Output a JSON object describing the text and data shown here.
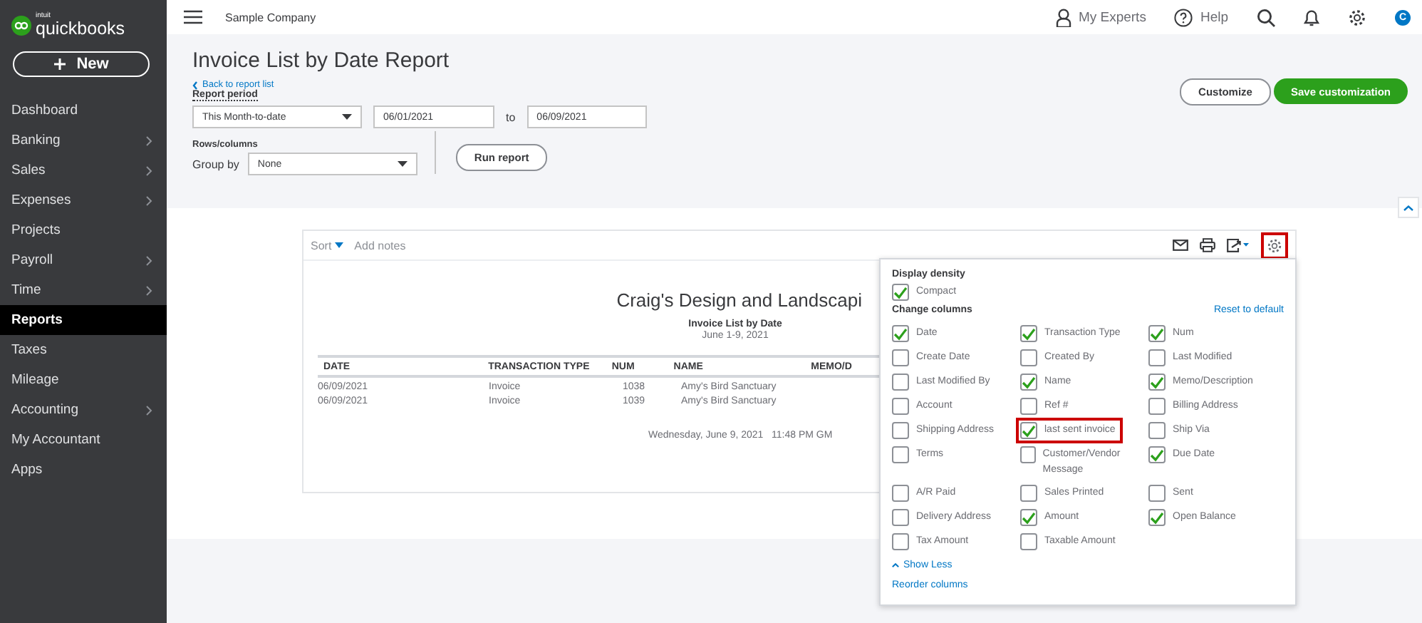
{
  "brand": {
    "small": "intuit",
    "name": "quickbooks"
  },
  "new_button": "New",
  "sidebar": {
    "items": [
      {
        "label": "Dashboard",
        "has_submenu": false,
        "selected": false
      },
      {
        "label": "Banking",
        "has_submenu": true,
        "selected": false
      },
      {
        "label": "Sales",
        "has_submenu": true,
        "selected": false
      },
      {
        "label": "Expenses",
        "has_submenu": true,
        "selected": false
      },
      {
        "label": "Projects",
        "has_submenu": false,
        "selected": false
      },
      {
        "label": "Payroll",
        "has_submenu": true,
        "selected": false
      },
      {
        "label": "Time",
        "has_submenu": true,
        "selected": false
      },
      {
        "label": "Reports",
        "has_submenu": false,
        "selected": true
      },
      {
        "label": "Taxes",
        "has_submenu": false,
        "selected": false
      },
      {
        "label": "Mileage",
        "has_submenu": false,
        "selected": false
      },
      {
        "label": "Accounting",
        "has_submenu": true,
        "selected": false
      },
      {
        "label": "My Accountant",
        "has_submenu": false,
        "selected": false
      },
      {
        "label": "Apps",
        "has_submenu": false,
        "selected": false
      }
    ]
  },
  "topbar": {
    "company": "Sample Company",
    "experts": "My Experts",
    "help": "Help",
    "avatar": "C"
  },
  "header": {
    "title": "Invoice List by Date Report",
    "back_link": "Back to report list",
    "period_label": "Report period",
    "period": "This Month-to-date",
    "from": "06/01/2021",
    "to_label": "to",
    "to": "06/09/2021",
    "rows_label": "Rows/columns",
    "group_label": "Group by",
    "group": "None",
    "run": "Run report",
    "customize": "Customize",
    "save": "Save customization"
  },
  "report": {
    "sort": "Sort",
    "notes": "Add notes",
    "settings_highlighted": true,
    "company": "Craig's Design and Landscapi",
    "title": "Invoice List by Date",
    "range": "June 1-9, 2021",
    "columns": [
      "DATE",
      "TRANSACTION TYPE",
      "NUM",
      "NAME",
      "MEMO/D"
    ],
    "rows": [
      [
        "06/09/2021",
        "Invoice",
        "1038",
        "Amy's Bird Sanctuary"
      ],
      [
        "06/09/2021",
        "Invoice",
        "1039",
        "Amy's Bird Sanctuary"
      ]
    ],
    "footer": "Wednesday, June 9, 2021   11:48 PM GM"
  },
  "settings_panel": {
    "density_label": "Display density",
    "density": [
      {
        "label": "Compact",
        "checked": true
      }
    ],
    "columns_label": "Change columns",
    "reset": "Reset to default",
    "columns": [
      {
        "label": "Date",
        "checked": true,
        "highlighted": false
      },
      {
        "label": "Transaction Type",
        "checked": true,
        "highlighted": false
      },
      {
        "label": "Num",
        "checked": true,
        "highlighted": false
      },
      {
        "label": "Create Date",
        "checked": false,
        "highlighted": false
      },
      {
        "label": "Created By",
        "checked": false,
        "highlighted": false
      },
      {
        "label": "Last Modified",
        "checked": false,
        "highlighted": false
      },
      {
        "label": "Last Modified By",
        "checked": false,
        "highlighted": false
      },
      {
        "label": "Name",
        "checked": true,
        "highlighted": false
      },
      {
        "label": "Memo/Description",
        "checked": true,
        "highlighted": false
      },
      {
        "label": "Account",
        "checked": false,
        "highlighted": false
      },
      {
        "label": "Ref #",
        "checked": false,
        "highlighted": false
      },
      {
        "label": "Billing Address",
        "checked": false,
        "highlighted": false
      },
      {
        "label": "Shipping Address",
        "checked": false,
        "highlighted": false
      },
      {
        "label": "last sent invoice",
        "checked": true,
        "highlighted": true
      },
      {
        "label": "Ship Via",
        "checked": false,
        "highlighted": false
      },
      {
        "label": "Terms",
        "checked": false,
        "highlighted": false
      },
      {
        "label": "Customer/Vendor Message",
        "checked": false,
        "highlighted": false
      },
      {
        "label": "Due Date",
        "checked": true,
        "highlighted": false
      },
      {
        "label": "A/R Paid",
        "checked": false,
        "highlighted": false
      },
      {
        "label": "Sales Printed",
        "checked": false,
        "highlighted": false
      },
      {
        "label": "Sent",
        "checked": false,
        "highlighted": false
      },
      {
        "label": "Delivery Address",
        "checked": false,
        "highlighted": false
      },
      {
        "label": "Amount",
        "checked": true,
        "highlighted": false
      },
      {
        "label": "Open Balance",
        "checked": true,
        "highlighted": false
      },
      {
        "label": "Tax Amount",
        "checked": false,
        "highlighted": false
      },
      {
        "label": "Taxable Amount",
        "checked": false,
        "highlighted": false
      }
    ],
    "show_less": "Show Less",
    "reorder": "Reorder columns"
  }
}
